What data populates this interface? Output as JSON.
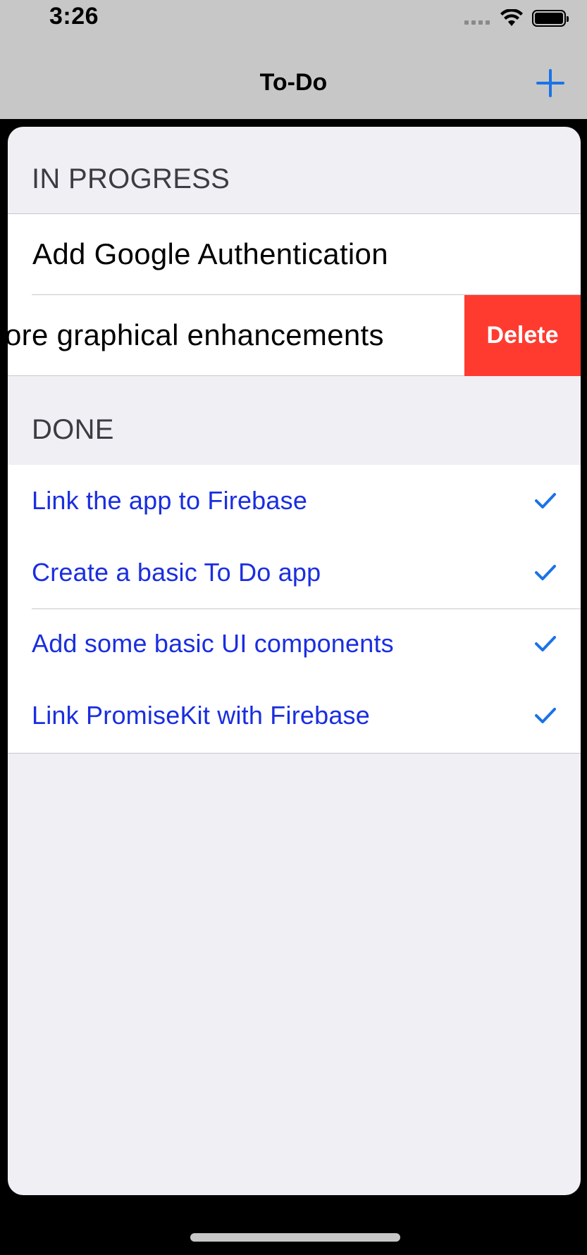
{
  "status_bar": {
    "time": "3:26"
  },
  "nav": {
    "title": "To-Do",
    "add_icon": "plus-icon"
  },
  "sections": {
    "in_progress": {
      "header": "IN PROGRESS",
      "items": [
        {
          "label": "Add Google Authentication"
        },
        {
          "label": "More graphical enhancements",
          "visible_label": "ore graphical enhancements",
          "swipe_action": "Delete"
        }
      ]
    },
    "done": {
      "header": "DONE",
      "items": [
        {
          "label": "Link the app to Firebase",
          "checked": true
        },
        {
          "label": "Create a basic To Do app",
          "checked": true
        },
        {
          "label": "Add some basic UI components",
          "checked": true
        },
        {
          "label": "Link PromiseKit with Firebase",
          "checked": true
        }
      ]
    }
  },
  "colors": {
    "accent": "#1a73e8",
    "done_text": "#1a2ee0",
    "delete": "#ff3b30",
    "nav_background": "#c7c7c7",
    "sheet_background": "#efeff4"
  }
}
